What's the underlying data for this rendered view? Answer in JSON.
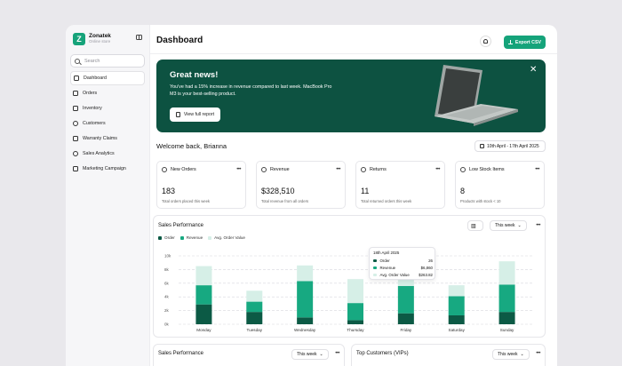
{
  "brand": {
    "name": "Zonatek",
    "sub": "Online store",
    "logo_letter": "Z",
    "accent": "#16a37a"
  },
  "sidebar": {
    "search_placeholder": "Search",
    "items": [
      {
        "label": "Dashboard",
        "icon": "home-icon"
      },
      {
        "label": "Orders",
        "icon": "box-icon"
      },
      {
        "label": "Inventory",
        "icon": "inventory-icon"
      },
      {
        "label": "Customers",
        "icon": "users-icon"
      },
      {
        "label": "Warranty Claims",
        "icon": "shield-icon"
      },
      {
        "label": "Sales Analytics",
        "icon": "analytics-icon"
      },
      {
        "label": "Marketing Campaign",
        "icon": "megaphone-icon"
      }
    ]
  },
  "header": {
    "title": "Dashboard",
    "export_label": "Export CSV"
  },
  "banner": {
    "title": "Great news!",
    "text": "You've had a 15% increase in revenue compared to last week. MacBook Pro M3 is your best-selling product.",
    "button": "View full report",
    "bg": "#0d5241"
  },
  "welcome": "Welcome back, Brianna",
  "date_range": "10th April - 17th April 2025",
  "stats": [
    {
      "label": "New Orders",
      "value": "183",
      "sub": "Total orders placed this week",
      "icon": "cart-icon"
    },
    {
      "label": "Revenue",
      "value": "$328,510",
      "sub": "Total revenue from all orders",
      "icon": "dollar-icon"
    },
    {
      "label": "Returns",
      "value": "11",
      "sub": "Total returned orders this week",
      "icon": "return-icon"
    },
    {
      "label": "Low Stock Items",
      "value": "8",
      "sub": "Products with stock < 10",
      "icon": "box-icon"
    }
  ],
  "sales": {
    "title": "Sales Performance",
    "period": "This week",
    "legend": [
      "Order",
      "Revenue",
      "Avg. Order Value"
    ],
    "tooltip": {
      "date": "18th April 2025",
      "rows": [
        {
          "label": "Order",
          "value": "26"
        },
        {
          "label": "Revenue",
          "value": "$6,860"
        },
        {
          "label": "Avg. Order Value",
          "value": "$263.82"
        }
      ]
    }
  },
  "chart_data": {
    "type": "bar",
    "stacked": true,
    "categories": [
      "Monday",
      "Tuesday",
      "Wednesday",
      "Thursday",
      "Friday",
      "Saturday",
      "Sunday"
    ],
    "y_ticks": [
      "0k",
      "2k",
      "4k",
      "6k",
      "8k",
      "10k"
    ],
    "ylim": [
      0,
      10
    ],
    "series": [
      {
        "name": "Order",
        "color": "#0c5a45",
        "values": [
          2.9,
          1.8,
          1.0,
          0.6,
          1.6,
          1.3,
          1.8
        ]
      },
      {
        "name": "Revenue",
        "color": "#17a981",
        "values": [
          2.8,
          1.5,
          5.3,
          2.5,
          4.0,
          2.8,
          4.0
        ]
      },
      {
        "name": "Avg. Order Value",
        "color": "#d6efe7",
        "values": [
          2.8,
          1.6,
          2.3,
          3.5,
          2.5,
          1.6,
          3.4
        ]
      }
    ],
    "grid": true,
    "legend": "top-left"
  },
  "bottom": {
    "left_title": "Sales Performance",
    "left_period": "This week",
    "right_title": "Top Customers (VIPs)",
    "right_period": "This week"
  }
}
